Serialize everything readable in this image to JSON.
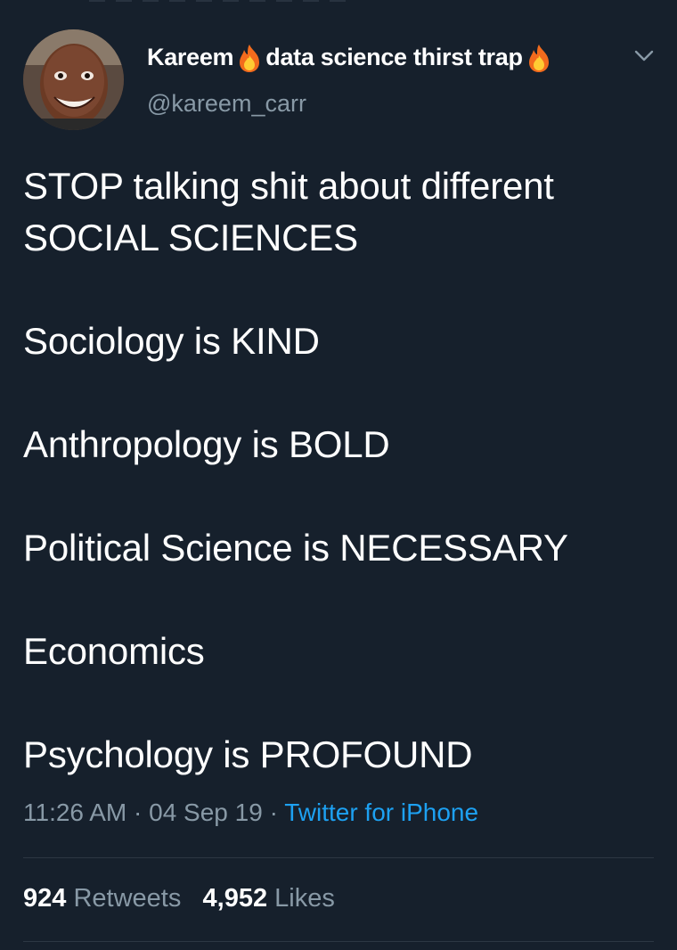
{
  "author": {
    "display_name_part1": "Kareem",
    "display_name_part2": "data science thirst trap",
    "emoji_icon": "fire-icon",
    "handle": "@kareem_carr"
  },
  "tweet": {
    "lines": [
      "STOP talking shit about different",
      "SOCIAL SCIENCES",
      "Sociology is KIND",
      "Anthropology is BOLD",
      "Political Science is NECESSARY",
      "Economics",
      "Psychology is PROFOUND"
    ]
  },
  "meta": {
    "time": "11:26 AM",
    "separator": "·",
    "date": "04 Sep 19",
    "source": "Twitter for iPhone"
  },
  "stats": {
    "retweets_count": "924",
    "retweets_label": "Retweets",
    "likes_count": "4,952",
    "likes_label": "Likes"
  },
  "colors": {
    "background": "#16202c",
    "text": "#ffffff",
    "secondary": "#8899a6",
    "link": "#1da1f2",
    "divider": "#2c3743"
  }
}
